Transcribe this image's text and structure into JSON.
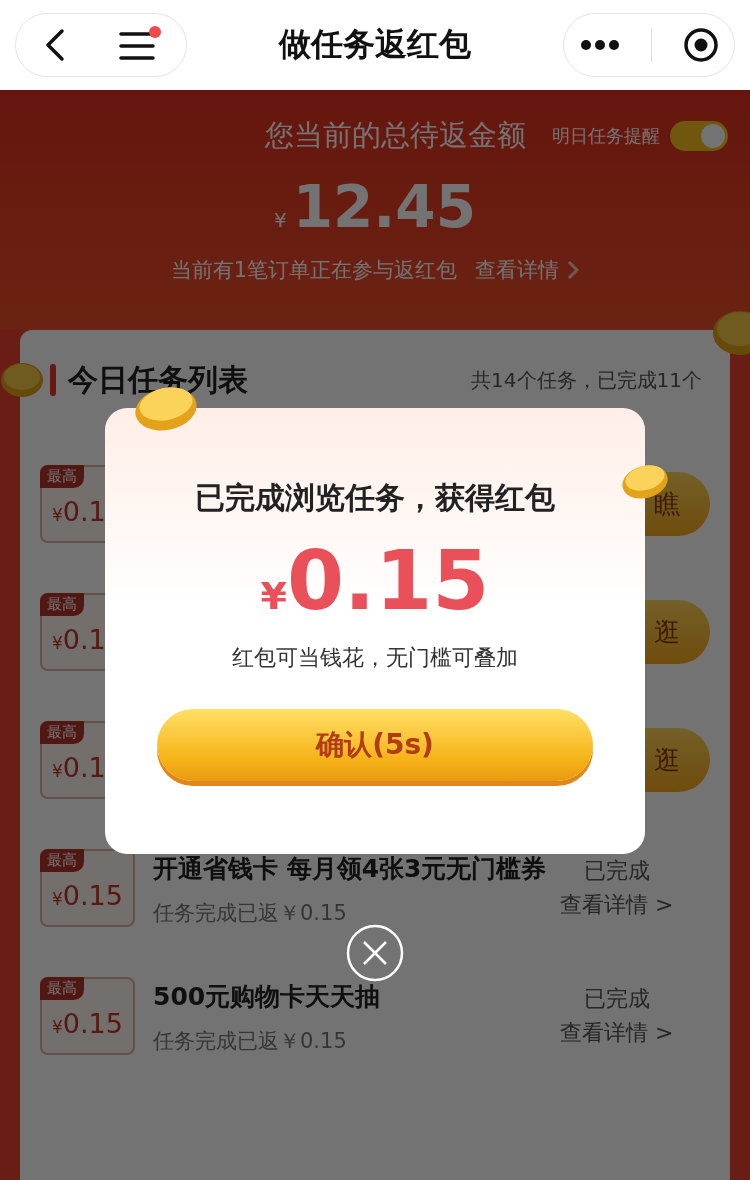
{
  "nav": {
    "title": "做任务返红包",
    "menu_dot": true
  },
  "header": {
    "label": "您当前的总待返金额",
    "reminder": {
      "label": "明日任务提醒",
      "on": true
    },
    "currency": "¥",
    "amount": "12.45",
    "orders_text": "当前有1笔订单正在参与返红包",
    "details_link": "查看详情"
  },
  "task_list": {
    "title": "今日任务列表",
    "summary": "共14个任务，已完成11个",
    "rows": [
      {
        "kind": "covered",
        "badge": "最高",
        "currency": "¥",
        "amount": "0.1",
        "action": "瞧"
      },
      {
        "kind": "covered",
        "badge": "最高",
        "currency": "¥",
        "amount": "0.1",
        "action": "逛"
      },
      {
        "kind": "covered",
        "badge": "最高",
        "currency": "¥",
        "amount": "0.1",
        "action": "逛"
      },
      {
        "kind": "done",
        "badge": "最高",
        "currency": "¥",
        "amount": "0.15",
        "title": "开通省钱卡 每月领4张3元无门槛券",
        "note": "任务完成已返￥0.15",
        "status": "已完成",
        "link": "查看详情 >"
      },
      {
        "kind": "done",
        "badge": "最高",
        "currency": "¥",
        "amount": "0.15",
        "title": "500元购物卡天天抽",
        "note": "任务完成已返￥0.15",
        "status": "已完成",
        "link": "查看详情 >"
      }
    ]
  },
  "dialog": {
    "title": "已完成浏览任务，获得红包",
    "currency": "¥",
    "amount": "0.15",
    "description": "红包可当钱花，无门槛可叠加",
    "confirm": "确认(5s)"
  }
}
